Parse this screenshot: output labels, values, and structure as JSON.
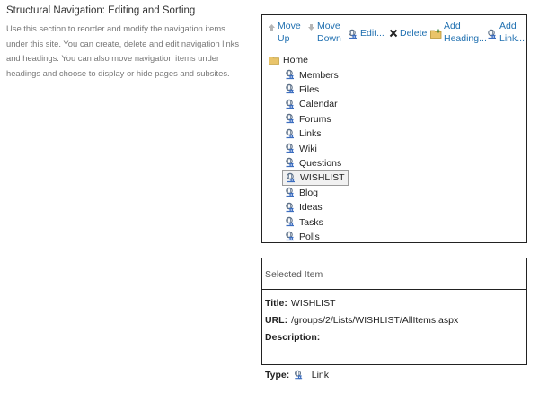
{
  "section": {
    "title": "Structural Navigation: Editing and Sorting",
    "description": "Use this section to reorder and modify the navigation items under this site. You can create, delete and edit navigation links and headings. You can also move navigation items under headings and choose to display or hide pages and subsites."
  },
  "toolbar": {
    "move_up": "Move\nUp",
    "move_down": "Move\nDown",
    "edit": "Edit...",
    "delete": "Delete",
    "add_heading": "Add\nHeading...",
    "add_link": "Add\nLink..."
  },
  "tree": {
    "root": "Home",
    "items": [
      "Members",
      "Files",
      "Calendar",
      "Forums",
      "Links",
      "Wiki",
      "Questions",
      "WISHLIST",
      "Blog",
      "Ideas",
      "Tasks",
      "Polls"
    ],
    "selected": "WISHLIST"
  },
  "selected_item": {
    "header": "Selected Item",
    "title_key": "Title:",
    "title_value": "WISHLIST",
    "url_key": "URL:",
    "url_value": "/groups/2/Lists/WISHLIST/AllItems.aspx",
    "description_key": "Description:",
    "description_value": "",
    "type_key": "Type:",
    "type_value": "Link"
  },
  "colors": {
    "link_blue": "#1e6fb0",
    "border": "#222222",
    "folder_yellow": "#e9c46a"
  },
  "icons": {
    "move_up": "arrow-up-icon",
    "move_down": "arrow-down-icon",
    "edit": "link-edit-icon",
    "delete": "delete-x-icon",
    "add_heading": "folder-add-icon",
    "add_link": "link-add-icon",
    "root": "folder-icon",
    "item": "link-icon"
  }
}
